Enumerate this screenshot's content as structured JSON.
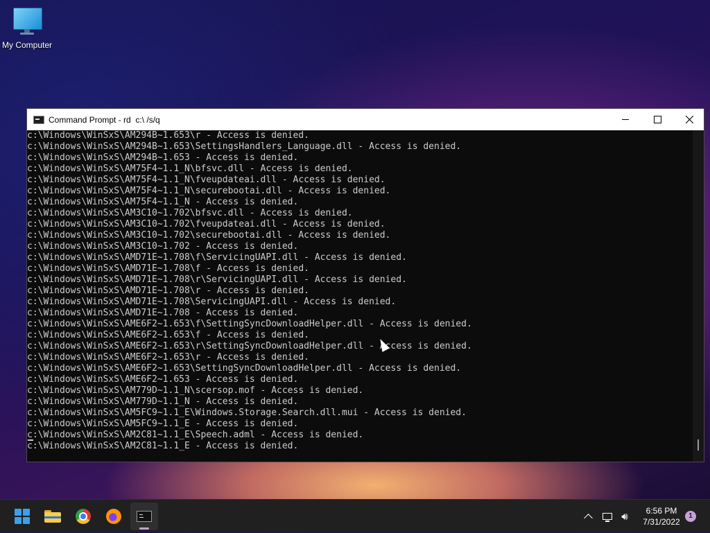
{
  "desktop": {
    "icons": [
      {
        "label": "My Computer",
        "icon": "monitor-icon"
      }
    ]
  },
  "window": {
    "title": "Command Prompt - rd  c:\\ /s/q",
    "controls": {
      "minimize": "minimize-icon",
      "maximize": "maximize-icon",
      "close": "close-icon"
    },
    "console_lines": [
      "c:\\Windows\\WinSxS\\AM294B~1.653\\r - Access is denied.",
      "c:\\Windows\\WinSxS\\AM294B~1.653\\SettingsHandlers_Language.dll - Access is denied.",
      "c:\\Windows\\WinSxS\\AM294B~1.653 - Access is denied.",
      "c:\\Windows\\WinSxS\\AM75F4~1.1_N\\bfsvc.dll - Access is denied.",
      "c:\\Windows\\WinSxS\\AM75F4~1.1_N\\fveupdateai.dll - Access is denied.",
      "c:\\Windows\\WinSxS\\AM75F4~1.1_N\\securebootai.dll - Access is denied.",
      "c:\\Windows\\WinSxS\\AM75F4~1.1_N - Access is denied.",
      "c:\\Windows\\WinSxS\\AM3C10~1.702\\bfsvc.dll - Access is denied.",
      "c:\\Windows\\WinSxS\\AM3C10~1.702\\fveupdateai.dll - Access is denied.",
      "c:\\Windows\\WinSxS\\AM3C10~1.702\\securebootai.dll - Access is denied.",
      "c:\\Windows\\WinSxS\\AM3C10~1.702 - Access is denied.",
      "c:\\Windows\\WinSxS\\AMD71E~1.708\\f\\ServicingUAPI.dll - Access is denied.",
      "c:\\Windows\\WinSxS\\AMD71E~1.708\\f - Access is denied.",
      "c:\\Windows\\WinSxS\\AMD71E~1.708\\r\\ServicingUAPI.dll - Access is denied.",
      "c:\\Windows\\WinSxS\\AMD71E~1.708\\r - Access is denied.",
      "c:\\Windows\\WinSxS\\AMD71E~1.708\\ServicingUAPI.dll - Access is denied.",
      "c:\\Windows\\WinSxS\\AMD71E~1.708 - Access is denied.",
      "c:\\Windows\\WinSxS\\AME6F2~1.653\\f\\SettingSyncDownloadHelper.dll - Access is denied.",
      "c:\\Windows\\WinSxS\\AME6F2~1.653\\f - Access is denied.",
      "c:\\Windows\\WinSxS\\AME6F2~1.653\\r\\SettingSyncDownloadHelper.dll - Access is denied.",
      "c:\\Windows\\WinSxS\\AME6F2~1.653\\r - Access is denied.",
      "c:\\Windows\\WinSxS\\AME6F2~1.653\\SettingSyncDownloadHelper.dll - Access is denied.",
      "c:\\Windows\\WinSxS\\AME6F2~1.653 - Access is denied.",
      "c:\\Windows\\WinSxS\\AM779D~1.1_N\\scersop.mof - Access is denied.",
      "c:\\Windows\\WinSxS\\AM779D~1.1_N - Access is denied.",
      "c:\\Windows\\WinSxS\\AM5FC9~1.1_E\\Windows.Storage.Search.dll.mui - Access is denied.",
      "c:\\Windows\\WinSxS\\AM5FC9~1.1_E - Access is denied.",
      "c:\\Windows\\WinSxS\\AM2C81~1.1_E\\Speech.adml - Access is denied.",
      "c:\\Windows\\WinSxS\\AM2C81~1.1_E - Access is denied."
    ]
  },
  "taskbar": {
    "apps": [
      {
        "name": "start",
        "icon": "windows-logo-icon"
      },
      {
        "name": "file-explorer",
        "icon": "folder-icon"
      },
      {
        "name": "chrome",
        "icon": "chrome-icon"
      },
      {
        "name": "firefox",
        "icon": "firefox-icon"
      },
      {
        "name": "command-prompt",
        "icon": "terminal-icon",
        "active": true
      }
    ],
    "tray": {
      "time": "6:56 PM",
      "date": "7/31/2022",
      "notification_count": "1"
    }
  }
}
